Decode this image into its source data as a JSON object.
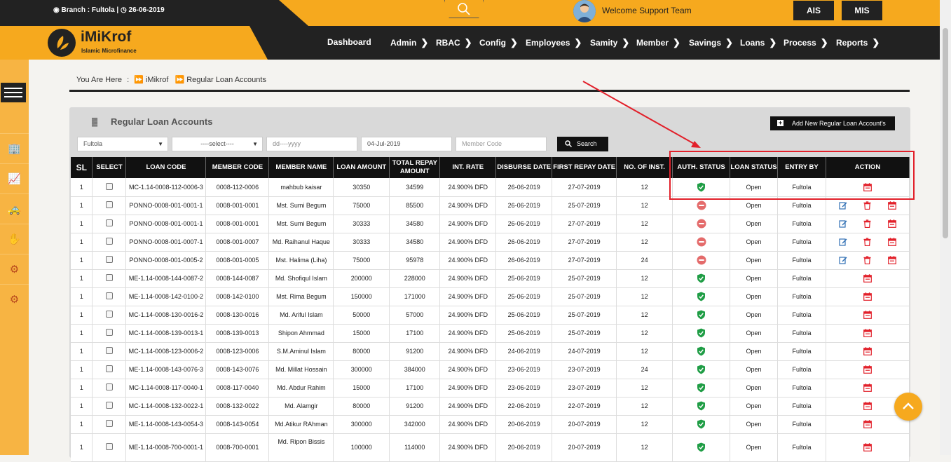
{
  "header": {
    "branch_label": "Branch : Fultola |",
    "date": "26-06-2019",
    "welcome": "Welcome Support Team",
    "sys_buttons": [
      "AIS",
      "MIS"
    ]
  },
  "brand": {
    "name": "iMiKrof",
    "tagline": "Islamic Microfinance"
  },
  "nav": [
    {
      "label": "Dashboard",
      "submenu": false
    },
    {
      "label": "Admin",
      "submenu": true
    },
    {
      "label": "RBAC",
      "submenu": true
    },
    {
      "label": "Config",
      "submenu": true
    },
    {
      "label": "Employees",
      "submenu": true
    },
    {
      "label": "Samity",
      "submenu": true
    },
    {
      "label": "Member",
      "submenu": true
    },
    {
      "label": "Savings",
      "submenu": true
    },
    {
      "label": "Loans",
      "submenu": true
    },
    {
      "label": "Process",
      "submenu": true
    },
    {
      "label": "Reports",
      "submenu": true
    }
  ],
  "breadcrumb": {
    "prefix": "You Are Here",
    "items": [
      "iMikrof",
      "Regular Loan Accounts"
    ]
  },
  "panel": {
    "title": "Regular Loan Accounts",
    "add_label": "Add New Regular Loan Account's"
  },
  "filters": {
    "branch": "Fultola",
    "select": "----select----",
    "date_placeholder": "dd----yyyy",
    "date_value": "04-Jul-2019",
    "member_placeholder": "Member Code",
    "search_label": "Search"
  },
  "table": {
    "headers": [
      "SL",
      "SELECT",
      "LOAN CODE",
      "MEMBER CODE",
      "MEMBER NAME",
      "LOAN AMOUNT",
      "TOTAL REPAY AMOUNT",
      "INT. RATE",
      "DISBURSE DATE",
      "FIRST REPAY DATE",
      "NO. OF INST.",
      "AUTH. STATUS",
      "LOAN STATUS",
      "ENTRY BY",
      "ACTION"
    ],
    "rows": [
      {
        "sl": "1",
        "loan_code": "MC-1.14-0008-112-0006-3",
        "member_code": "0008-112-0006",
        "member_name": "mahbub kaisar",
        "loan_amount": "30350",
        "total_repay": "34599",
        "int_rate": "24.900% DFD",
        "disburse": "26-06-2019",
        "first_repay": "27-07-2019",
        "inst": "12",
        "auth": "approved",
        "status": "Open",
        "entry_by": "Fultola",
        "actions": [
          "calendar"
        ]
      },
      {
        "sl": "1",
        "loan_code": "PONNO-0008-001-0001-1",
        "member_code": "0008-001-0001",
        "member_name": "Mst. Sumi Begum",
        "loan_amount": "75000",
        "total_repay": "85500",
        "int_rate": "24.900% DFD",
        "disburse": "26-06-2019",
        "first_repay": "25-07-2019",
        "inst": "12",
        "auth": "pending",
        "status": "Open",
        "entry_by": "Fultola",
        "actions": [
          "edit",
          "delete",
          "calendar"
        ]
      },
      {
        "sl": "1",
        "loan_code": "PONNO-0008-001-0001-1",
        "member_code": "0008-001-0001",
        "member_name": "Mst. Sumi Begum",
        "loan_amount": "30333",
        "total_repay": "34580",
        "int_rate": "24.900% DFD",
        "disburse": "26-06-2019",
        "first_repay": "27-07-2019",
        "inst": "12",
        "auth": "pending",
        "status": "Open",
        "entry_by": "Fultola",
        "actions": [
          "edit",
          "delete",
          "calendar"
        ]
      },
      {
        "sl": "1",
        "loan_code": "PONNO-0008-001-0007-1",
        "member_code": "0008-001-0007",
        "member_name": "Md. Raihanul Haque",
        "loan_amount": "30333",
        "total_repay": "34580",
        "int_rate": "24.900% DFD",
        "disburse": "26-06-2019",
        "first_repay": "27-07-2019",
        "inst": "12",
        "auth": "pending",
        "status": "Open",
        "entry_by": "Fultola",
        "actions": [
          "edit",
          "delete",
          "calendar"
        ]
      },
      {
        "sl": "1",
        "loan_code": "PONNO-0008-001-0005-2",
        "member_code": "0008-001-0005",
        "member_name": "Mst. Halima (Liha)",
        "loan_amount": "75000",
        "total_repay": "95978",
        "int_rate": "24.900% DFD",
        "disburse": "26-06-2019",
        "first_repay": "27-07-2019",
        "inst": "24",
        "auth": "pending",
        "status": "Open",
        "entry_by": "Fultola",
        "actions": [
          "edit",
          "delete",
          "calendar"
        ]
      },
      {
        "sl": "1",
        "loan_code": "ME-1.14-0008-144-0087-2",
        "member_code": "0008-144-0087",
        "member_name": "Md. Shofiqul Islam",
        "loan_amount": "200000",
        "total_repay": "228000",
        "int_rate": "24.900% DFD",
        "disburse": "25-06-2019",
        "first_repay": "25-07-2019",
        "inst": "12",
        "auth": "approved",
        "status": "Open",
        "entry_by": "Fultola",
        "actions": [
          "calendar"
        ]
      },
      {
        "sl": "1",
        "loan_code": "ME-1.14-0008-142-0100-2",
        "member_code": "0008-142-0100",
        "member_name": "Mst. Rima Begum",
        "loan_amount": "150000",
        "total_repay": "171000",
        "int_rate": "24.900% DFD",
        "disburse": "25-06-2019",
        "first_repay": "25-07-2019",
        "inst": "12",
        "auth": "approved",
        "status": "Open",
        "entry_by": "Fultola",
        "actions": [
          "calendar"
        ]
      },
      {
        "sl": "1",
        "loan_code": "MC-1.14-0008-130-0016-2",
        "member_code": "0008-130-0016",
        "member_name": "Md. Ariful Islam",
        "loan_amount": "50000",
        "total_repay": "57000",
        "int_rate": "24.900% DFD",
        "disburse": "25-06-2019",
        "first_repay": "25-07-2019",
        "inst": "12",
        "auth": "approved",
        "status": "Open",
        "entry_by": "Fultola",
        "actions": [
          "calendar"
        ]
      },
      {
        "sl": "1",
        "loan_code": "MC-1.14-0008-139-0013-1",
        "member_code": "0008-139-0013",
        "member_name": "Shipon Ahmmad",
        "loan_amount": "15000",
        "total_repay": "17100",
        "int_rate": "24.900% DFD",
        "disburse": "25-06-2019",
        "first_repay": "25-07-2019",
        "inst": "12",
        "auth": "approved",
        "status": "Open",
        "entry_by": "Fultola",
        "actions": [
          "calendar"
        ]
      },
      {
        "sl": "1",
        "loan_code": "MC-1.14-0008-123-0006-2",
        "member_code": "0008-123-0006",
        "member_name": "S.M.Aminul Islam",
        "loan_amount": "80000",
        "total_repay": "91200",
        "int_rate": "24.900% DFD",
        "disburse": "24-06-2019",
        "first_repay": "24-07-2019",
        "inst": "12",
        "auth": "approved",
        "status": "Open",
        "entry_by": "Fultola",
        "actions": [
          "calendar"
        ]
      },
      {
        "sl": "1",
        "loan_code": "ME-1.14-0008-143-0076-3",
        "member_code": "0008-143-0076",
        "member_name": "Md. Millat Hossain",
        "loan_amount": "300000",
        "total_repay": "384000",
        "int_rate": "24.900% DFD",
        "disburse": "23-06-2019",
        "first_repay": "23-07-2019",
        "inst": "24",
        "auth": "approved",
        "status": "Open",
        "entry_by": "Fultola",
        "actions": [
          "calendar"
        ]
      },
      {
        "sl": "1",
        "loan_code": "MC-1.14-0008-117-0040-1",
        "member_code": "0008-117-0040",
        "member_name": "Md. Abdur Rahim",
        "loan_amount": "15000",
        "total_repay": "17100",
        "int_rate": "24.900% DFD",
        "disburse": "23-06-2019",
        "first_repay": "23-07-2019",
        "inst": "12",
        "auth": "approved",
        "status": "Open",
        "entry_by": "Fultola",
        "actions": [
          "calendar"
        ]
      },
      {
        "sl": "1",
        "loan_code": "MC-1.14-0008-132-0022-1",
        "member_code": "0008-132-0022",
        "member_name": "Md. Alamgir",
        "loan_amount": "80000",
        "total_repay": "91200",
        "int_rate": "24.900% DFD",
        "disburse": "22-06-2019",
        "first_repay": "22-07-2019",
        "inst": "12",
        "auth": "approved",
        "status": "Open",
        "entry_by": "Fultola",
        "actions": [
          "calendar"
        ]
      },
      {
        "sl": "1",
        "loan_code": "ME-1.14-0008-143-0054-3",
        "member_code": "0008-143-0054",
        "member_name": "Md.Atikur RAhman",
        "loan_amount": "300000",
        "total_repay": "342000",
        "int_rate": "24.900% DFD",
        "disburse": "20-06-2019",
        "first_repay": "20-07-2019",
        "inst": "12",
        "auth": "approved",
        "status": "Open",
        "entry_by": "Fultola",
        "actions": [
          "calendar"
        ]
      },
      {
        "sl": "1",
        "loan_code": "ME-1.14-0008-700-0001-1",
        "member_code": "0008-700-0001",
        "member_name": "Md. Ripon Bissis",
        "loan_amount": "100000",
        "total_repay": "114000",
        "int_rate": "24.900% DFD",
        "disburse": "20-06-2019",
        "first_repay": "20-07-2019",
        "inst": "12",
        "auth": "approved",
        "status": "Open",
        "entry_by": "Fultola",
        "actions": [
          "calendar"
        ]
      }
    ]
  },
  "colors": {
    "accent": "#f6a91e",
    "dark": "#222222",
    "approved": "#1f9d45",
    "pending": "#e46b6b",
    "highlight": "#e2202a"
  },
  "icons": {
    "sidebar": [
      "building-icon",
      "chart-icon",
      "taxi-icon",
      "hand-coin-icon",
      "gear-icon",
      "settings-icon"
    ]
  }
}
